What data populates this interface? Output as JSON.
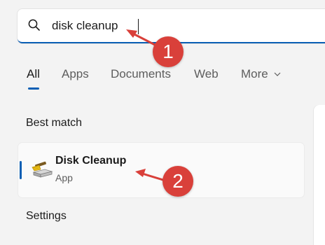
{
  "search": {
    "value": "disk cleanup"
  },
  "tabs": [
    {
      "label": "All"
    },
    {
      "label": "Apps"
    },
    {
      "label": "Documents"
    },
    {
      "label": "Web"
    },
    {
      "label": "More"
    }
  ],
  "sections": {
    "best_match": "Best match",
    "settings": "Settings"
  },
  "result": {
    "name": "Disk Cleanup",
    "type": "App",
    "icon": "disk-cleanup-icon"
  },
  "annotations": [
    {
      "number": "1"
    },
    {
      "number": "2"
    }
  ],
  "colors": {
    "accent": "#0a5fb4",
    "annotation": "#d9403a",
    "background": "#f3f3f3"
  }
}
